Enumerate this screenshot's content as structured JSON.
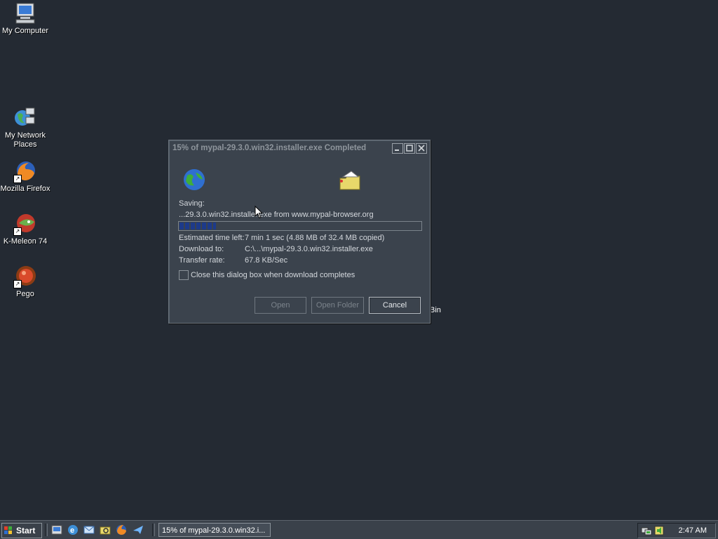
{
  "desktop": {
    "icons": [
      {
        "label": "My Computer",
        "icon": "computer-icon"
      },
      {
        "label": "My Network Places",
        "icon": "network-icon"
      },
      {
        "label": "Mozilla Firefox",
        "icon": "firefox-icon"
      },
      {
        "label": "K-Meleon 74",
        "icon": "k-meleon-icon"
      },
      {
        "label": "Pego",
        "icon": "pego-icon"
      }
    ],
    "partial_behind_text": "Bin"
  },
  "dialog": {
    "title": "15% of mypal-29.3.0.win32.installer.exe Completed",
    "saving_label": "Saving:",
    "saving_file": "...29.3.0.win32.installer.exe from www.mypal-browser.org",
    "progress_fraction": 0.15,
    "estimated_label": "Estimated time left:",
    "estimated_value": "7 min 1 sec (4.88 MB of 32.4 MB copied)",
    "download_to_label": "Download to:",
    "download_to_value": "C:\\...\\mypal-29.3.0.win32.installer.exe",
    "transfer_rate_label": "Transfer rate:",
    "transfer_rate_value": "67.8 KB/Sec",
    "close_checkbox_label": "Close this dialog box when download completes",
    "close_checkbox_checked": false,
    "open_label": "Open",
    "open_folder_label": "Open Folder",
    "cancel_label": "Cancel"
  },
  "taskbar": {
    "start_label": "Start",
    "task_label": "15% of mypal-29.3.0.win32.i...",
    "clock": "2:47 AM"
  },
  "colors": {
    "desktop": "#242a33",
    "dialog_bg": "#3b434d",
    "progress": "#1d3a8a"
  }
}
